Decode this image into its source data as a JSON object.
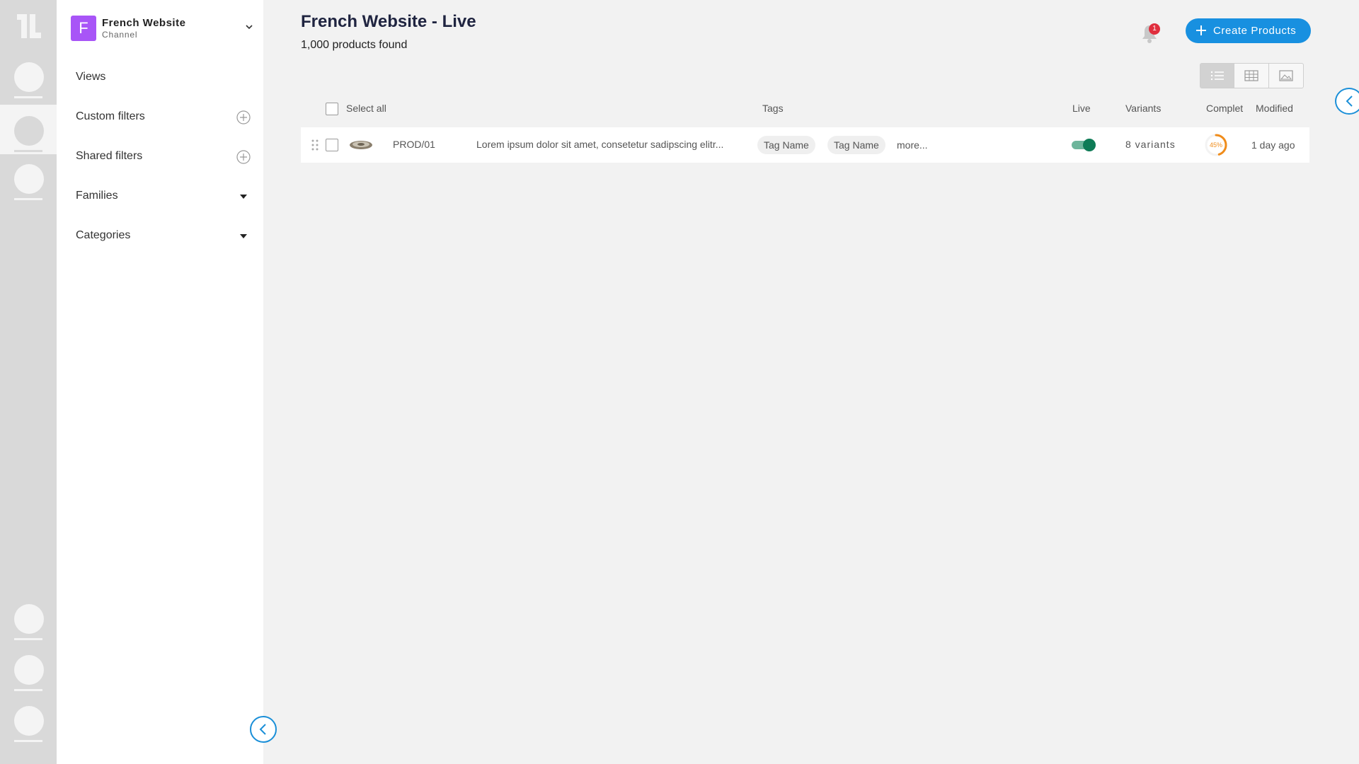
{
  "channel": {
    "initial": "F",
    "name": "French Website",
    "type": "Channel"
  },
  "sidebar": {
    "items": [
      {
        "label": "Views"
      },
      {
        "label": "Custom filters"
      },
      {
        "label": "Shared filters"
      },
      {
        "label": "Families"
      },
      {
        "label": "Categories"
      }
    ]
  },
  "header": {
    "title": "French Website - Live",
    "count": "1,000 products found",
    "notification_count": "1",
    "create_label": "Create Products"
  },
  "table": {
    "select_all": "Select all",
    "columns": {
      "tags": "Tags",
      "live": "Live",
      "variants": "Variants",
      "complete": "Complet",
      "modified": "Modified"
    },
    "rows": [
      {
        "sku": "PROD/01",
        "description": "Lorem ipsum dolor sit amet, consetetur sadipscing elitr...",
        "tags": [
          "Tag Name",
          "Tag Name"
        ],
        "more": "more...",
        "live": true,
        "variants": "8 variants",
        "completeness": 45,
        "completeness_label": "45%",
        "modified": "1 day ago"
      }
    ]
  },
  "colors": {
    "accent": "#1890e0",
    "avatar": "#a855f7",
    "badge": "#e02f3e",
    "live_on": "#0e7b56",
    "completeness": "#f08c1a"
  },
  "icons": [
    "logo-icon",
    "bell-icon",
    "plus-icon",
    "chevron-down-icon",
    "caret-down-icon",
    "list-view-icon",
    "table-view-icon",
    "image-view-icon",
    "drag-handle-icon",
    "chevron-left-icon"
  ]
}
